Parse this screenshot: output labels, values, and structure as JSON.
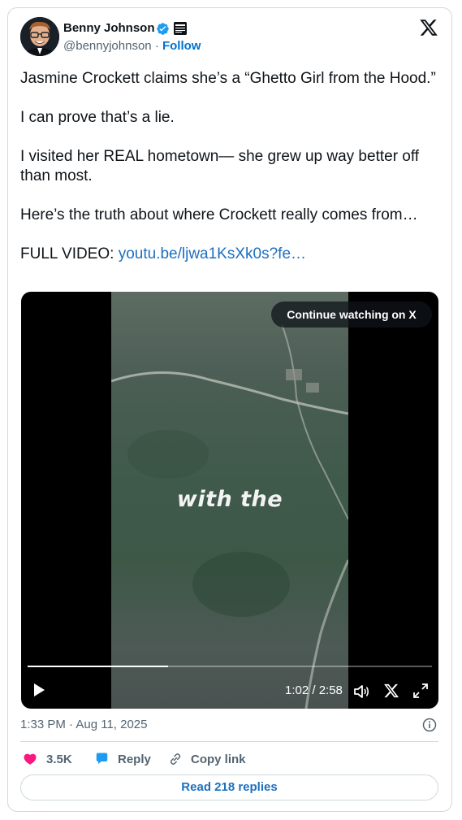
{
  "author": {
    "name": "Benny Johnson",
    "handle": "@bennyjohnson",
    "separator": "·",
    "follow_label": "Follow"
  },
  "tweet": {
    "paragraphs": [
      "Jasmine Crockett claims she’s a “Ghetto Girl from the Hood.”",
      "I can prove that’s a lie.",
      "I visited her REAL hometown— she grew up way better off than most.",
      "Here’s the truth about where Crockett really comes from…"
    ],
    "video_prefix": "FULL VIDEO: ",
    "video_link": "youtu.be/ljwa1KsXk0s?fe…"
  },
  "video": {
    "caption": "with the",
    "continue_label": "Continue watching on X",
    "time_display": "1:02 / 2:58",
    "progress": 0.348
  },
  "timestamp": "1:33 PM · Aug 11, 2025",
  "actions": {
    "likes": "3.5K",
    "reply_label": "Reply",
    "copy_label": "Copy link"
  },
  "read_replies_label": "Read 218 replies",
  "colors": {
    "accent": "#1d9bf0",
    "link": "#1d6fc0",
    "heart": "#f91880",
    "text": "#0f1419",
    "muted": "#536471"
  }
}
